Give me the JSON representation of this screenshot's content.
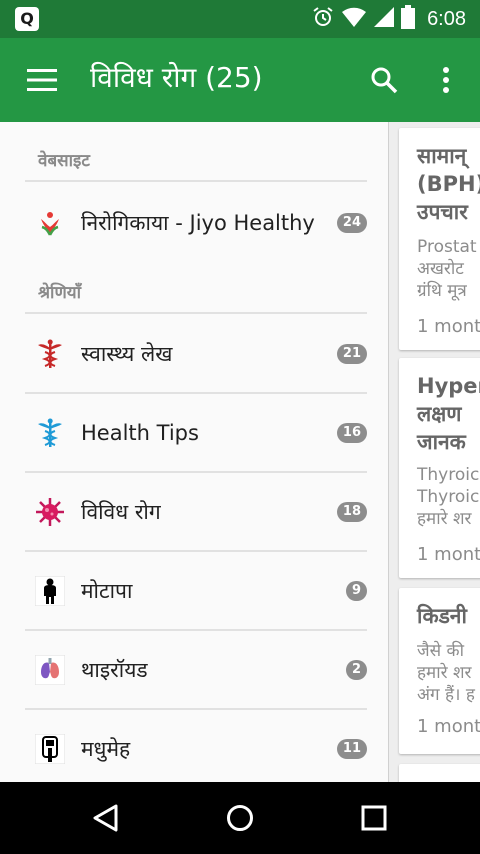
{
  "statusbar": {
    "app_badge": "Q",
    "time": "6:08",
    "icons": [
      "alarm-icon",
      "wifi-icon",
      "cell-signal-icon",
      "battery-icon"
    ]
  },
  "appbar": {
    "title": "विविध रोग (25)",
    "icons": [
      "menu-icon",
      "search-icon",
      "more-vert-icon"
    ]
  },
  "drawer": {
    "website_heading": "वेबसाइट",
    "website_item": {
      "label": "निरोगिकाया - Jiyo Healthy",
      "count": "24",
      "icon": "logo-icon"
    },
    "categories_heading": "श्रेणियाँ",
    "categories": [
      {
        "label": "स्वास्थ्य लेख",
        "count": "21",
        "icon": "caduceus-red-icon"
      },
      {
        "label": "Health Tips",
        "count": "16",
        "icon": "caduceus-blue-icon"
      },
      {
        "label": "विविध रोग",
        "count": "18",
        "icon": "virus-icon"
      },
      {
        "label": "मोटापा",
        "count": "9",
        "icon": "person-silhouette-icon"
      },
      {
        "label": "थाइरॉयड",
        "count": "2",
        "icon": "thyroid-icon"
      },
      {
        "label": "मधुमेह",
        "count": "11",
        "icon": "glucometer-icon"
      }
    ]
  },
  "posts": [
    {
      "title": "सामान्\n(BPH)\nउपचार",
      "excerpt": "Prostat\nअखरोट\nग्रंथि मूत्र",
      "time": "1 mont"
    },
    {
      "title": "Hyper\nलक्षण\nजानक",
      "excerpt": "Thyroic\nThyroic\nहमारे शर",
      "time": "1 mont"
    },
    {
      "title": "किडनी",
      "excerpt": "जैसे की\nहमारे शर\nअंग हैं। ह",
      "time": "1 mont"
    }
  ],
  "navbar": {
    "icons": [
      "back-icon",
      "home-icon",
      "recents-icon"
    ]
  },
  "colors": {
    "status_bar": "#1f7a37",
    "app_bar": "#249744",
    "badge": "#8d8d8d"
  }
}
